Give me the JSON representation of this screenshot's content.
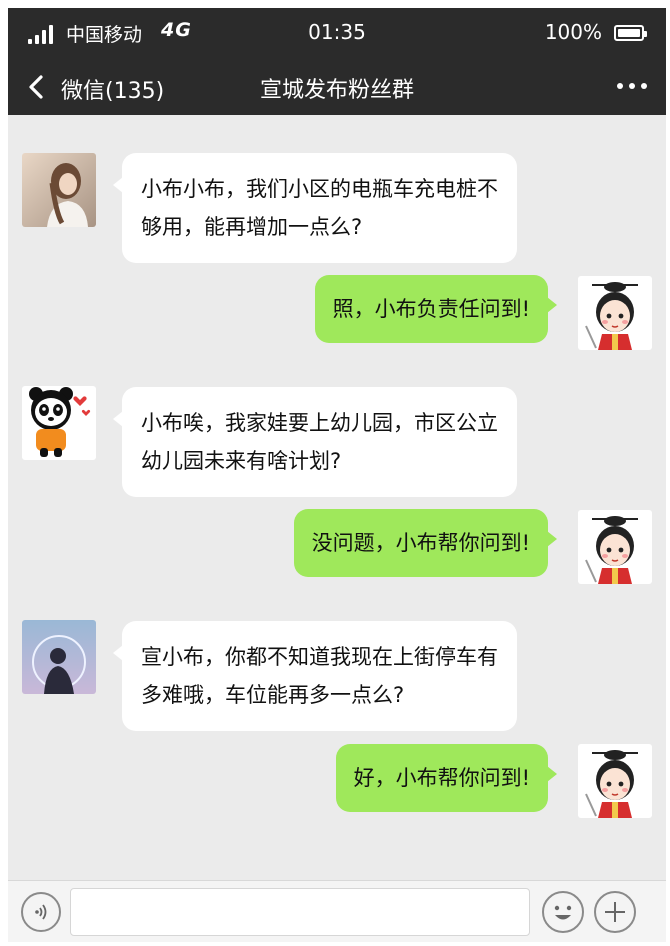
{
  "status_bar": {
    "carrier": "中国移动",
    "network": "4G",
    "time": "01:35",
    "battery_percent": "100%",
    "battery_level": 1.0
  },
  "nav": {
    "back_label": "微信(135)",
    "title": "宣城发布粉丝群",
    "icons": {
      "back": "chevron-left-icon",
      "more": "more-dots-icon"
    }
  },
  "messages": [
    {
      "side": "left",
      "avatar": "girl-photo-avatar",
      "text": "小布小布，我们小区的电瓶车充电桩不够用，能再增加一点么?"
    },
    {
      "side": "right",
      "avatar": "cartoon-mascot-avatar",
      "text": "照，小布负责任问到!"
    },
    {
      "side": "left",
      "avatar": "panda-cartoon-avatar",
      "text": "小布唉，我家娃要上幼儿园，市区公立幼儿园未来有啥计划?"
    },
    {
      "side": "right",
      "avatar": "cartoon-mascot-avatar",
      "text": "没问题，小布帮你问到!"
    },
    {
      "side": "left",
      "avatar": "silhouette-photo-avatar",
      "text": "宣小布，你都不知道我现在上街停车有多难哦，车位能再多一点么?"
    },
    {
      "side": "right",
      "avatar": "cartoon-mascot-avatar",
      "text": "好，小布帮你问到!"
    }
  ],
  "input_bar": {
    "placeholder": "",
    "icons": {
      "voice": "voice-icon",
      "emoji": "emoji-icon",
      "add": "plus-icon"
    }
  },
  "colors": {
    "header_bg": "#2b2b2b",
    "chat_bg": "#ebebeb",
    "sent_bubble": "#9fe85b",
    "received_bubble": "#ffffff"
  }
}
